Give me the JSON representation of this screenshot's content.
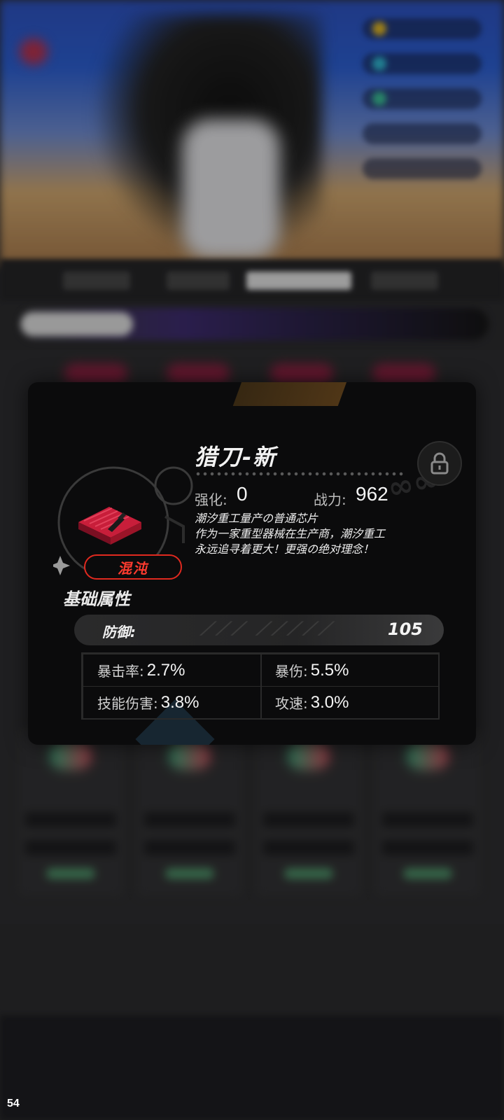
{
  "chip": {
    "name": "猎刀-新",
    "rarity": "混沌",
    "enhance_label": "强化:",
    "enhance_value": "0",
    "power_label": "战力:",
    "power_value": "962",
    "description_line1": "潮汐重工量产の普通芯片",
    "description_line2": "作为一家重型器械在生产商，潮汐重工",
    "description_line3": "永远追寻着更大！更强の绝对理念！",
    "locked": false
  },
  "base_attributes": {
    "title": "基础属性",
    "main_stat": {
      "label": "防御:",
      "value": "105"
    }
  },
  "sub_stats": [
    {
      "label": "暴击率:",
      "value": "2.7%"
    },
    {
      "label": "暴伤:",
      "value": "5.5%"
    },
    {
      "label": "技能伤害:",
      "value": "3.8%"
    },
    {
      "label": "攻速:",
      "value": "3.0%"
    }
  ],
  "fps_counter": "54",
  "colors": {
    "panel_bg": "#0b0b0c",
    "rarity_red": "#e0291f",
    "text": "#f2f2f2"
  },
  "icons": {
    "chip_emblem": "red-chip-icon",
    "lock": "lock-icon"
  }
}
